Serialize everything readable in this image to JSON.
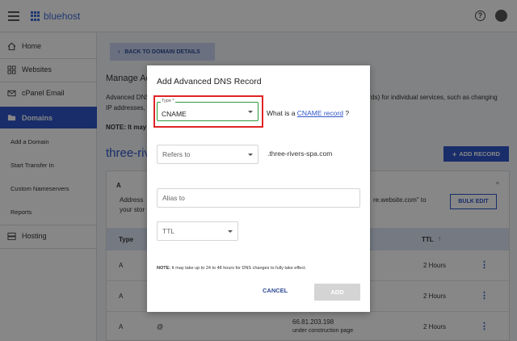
{
  "header": {
    "logo_text": "bluehost"
  },
  "sidebar": {
    "items": [
      {
        "label": "Home",
        "icon": "home-icon"
      },
      {
        "label": "Websites",
        "icon": "grid-icon"
      },
      {
        "label": "cPanel Email",
        "icon": "mail-icon"
      },
      {
        "label": "Domains",
        "icon": "folder-icon",
        "active": true
      },
      {
        "label": "Hosting",
        "icon": "server-icon"
      }
    ],
    "subitems": [
      "Add a Domain",
      "Start Transfer In",
      "Custom Nameservers",
      "Reports"
    ]
  },
  "main": {
    "back_label": "BACK TO DOMAIN DETAILS",
    "heading_partial": "Manage Ac",
    "desc_line1": "Advanced DNS",
    "desc_line2": "IP addresses,",
    "desc_right": "ords) for individual services, such as changing",
    "note_bold": "NOTE: It may",
    "domain_partial": "three-rivers",
    "add_record_label": "ADD RECORD",
    "panel": {
      "section": "A",
      "addr_line1": "Address",
      "addr_line2": "your stor",
      "addr_right": "re.website.com\" to",
      "bulk_edit_label": "BULK EDIT",
      "columns": {
        "type": "Type",
        "ttl": "TTL"
      },
      "rows": [
        {
          "type": "A",
          "host": "",
          "value": "",
          "value_sub": "",
          "ttl": "2 Hours"
        },
        {
          "type": "A",
          "host": "",
          "value": "",
          "value_sub": "",
          "ttl": "2 Hours"
        },
        {
          "type": "A",
          "host": "@",
          "value": "66.81.203.198",
          "value_sub": "under construction page",
          "ttl": "2 Hours"
        }
      ]
    }
  },
  "modal": {
    "title": "Add Advanced DNS Record",
    "type_label": "Type *",
    "type_value": "CNAME",
    "what_is_prefix": "What is a ",
    "what_is_link": "CNAME record",
    "what_is_suffix": " ?",
    "refers_to_placeholder": "Refers to",
    "refers_suffix": ".three-rivers-spa.com",
    "alias_placeholder": "Alias to",
    "ttl_placeholder": "TTL",
    "note_bold": "NOTE:",
    "note_text": " It may take up to 24 to 48 hours for DNS changes to fully take effect.",
    "cancel_label": "CANCEL",
    "add_label": "ADD"
  },
  "colors": {
    "brand": "#2f55c9",
    "highlight_border": "#e02424",
    "field_focus": "#2f9a3c"
  }
}
